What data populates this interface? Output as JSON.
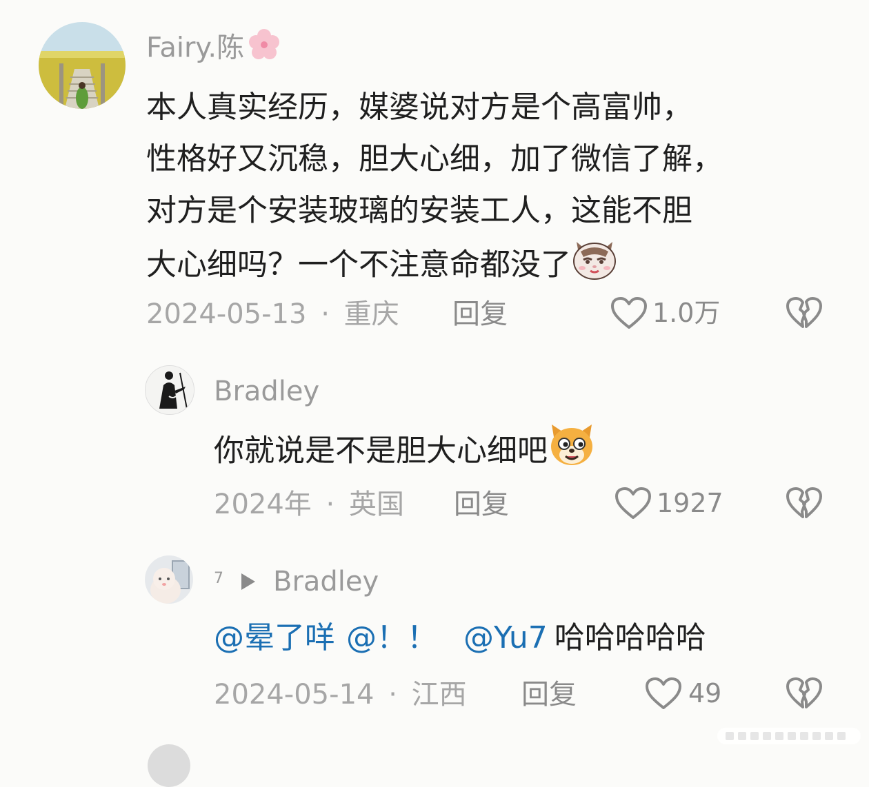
{
  "comments": [
    {
      "username": "Fairy.陈",
      "username_emoji": "cherry-blossom-emoji",
      "text_lines": [
        "本人真实经历，媒婆说对方是个高富帅，",
        "性格好又沉稳，胆大心细，加了微信了解，",
        "对方是个安装玻璃的安装工人，这能不胆",
        "大心细吗？一个不注意命都没了"
      ],
      "text_emoji": "smirking-cat-emoji",
      "date": "2024-05-13",
      "location": "重庆",
      "reply_label": "回复",
      "likes": "1.0万"
    },
    {
      "username": "Bradley",
      "text": "你就说是不是胆大心细吧",
      "text_emoji": "grinning-dog-emoji",
      "date": "2024年",
      "location": "英国",
      "reply_label": "回复",
      "likes": "1927"
    },
    {
      "username_prefix": "7",
      "username": "Bradley",
      "mentions": [
        "@晕了咩",
        "@！！",
        "@Yu7"
      ],
      "text": "哈哈哈哈哈",
      "date": "2024-05-14",
      "location": "江西",
      "reply_label": "回复",
      "likes": "49"
    }
  ],
  "separator": "·",
  "colors": {
    "background": "#fbfbf9",
    "text": "#1f1f1f",
    "muted": "#a6a6a6",
    "mention": "#1b6fb3"
  },
  "icons": [
    "heart-outline-icon",
    "broken-heart-icon",
    "play-triangle-icon"
  ]
}
